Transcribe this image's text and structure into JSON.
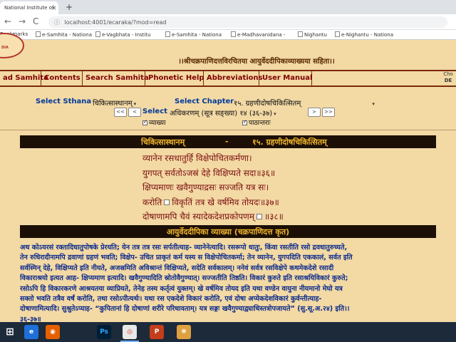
{
  "browser": {
    "tab_title": "National Institute of",
    "tab_close": "×",
    "new_tab": "+",
    "back": "←",
    "forward": "→",
    "reload": "C",
    "url": "localhost:4001/ecaraka/?mod=read",
    "url_icon": "ⓘ",
    "bookmarks": [
      "Bookmarks",
      "e-Samhita - Nationa",
      "e-Vagbhata - Institu",
      "e-Samhita - Nationa",
      "e-Madhavanidana -",
      "Nighantu",
      "e-Nighantu - Nationa"
    ]
  },
  "header": {
    "logo_text": "DIA",
    "subtitle": "।।श्रीचक्रपाणिदत्तविरचितया आयुर्वेददीपिकाव्याख्यया सहिता।।"
  },
  "menu": {
    "items": [
      "ad Samhita",
      "Contents",
      "Search Samhita",
      "Phonetic Help",
      "Abbreviations",
      "User Manual"
    ],
    "right_line1": "Cho",
    "right_line2": "DE"
  },
  "selectors": {
    "sthana_label": "Select Sthana",
    "sthana_value": "चिकित्सास्थानम्",
    "chapter_label": "Select Chapter",
    "chapter_value": "१५. ग्रहणीदोषचिकित्सितम्",
    "select_label": "Select",
    "adhikarana_value": "अधिकरणम् (सूत्र सङ्ख्या)   १४ (३६-३७)",
    "first_btn": "<<",
    "prev_btn": "<",
    "next_btn": ">",
    "last_btn": ">>",
    "caret": "▾",
    "vyakhya_label": "व्याख्या",
    "pathantara_label": "पाठान्तराः"
  },
  "section_header": {
    "sthana": "चिकित्सास्थानम्",
    "dash": "-",
    "chapter": "१५. ग्रहणीदोषचिकित्सितम्"
  },
  "verses": [
    "व्यानेन रसधातुर्हि विक्षेपोचितकर्मणा।",
    "युगपत् सर्वतोऽजस्रं देहे विक्षिप्यते सदा॥३६॥",
    "क्षिप्यमाणः खवैगुण्याद्रसः सज्जति यत्र सः।",
    "करोति",
    "विकृतिं तत्र खे वर्षमिव तोयदः॥३७॥",
    "दोषाणामपि चैवं स्यादेकदेशप्रकोपणम्",
    "॥३८॥"
  ],
  "commentary": {
    "title": "आयुर्वेददीपिका व्याख्या (चक्रपाणिदत्त कृत)",
    "lines": [
      "अथ कोऽयरसं रक्तादिधातुपोषके प्रेरयति; येन तत्र तत्र रसः सर्पतीत्याह- व्यानेनेत्यादि। रसरूपो धातुः, किंवा रसतीति रसो द्रवधातुरुच्यते,",
      "तेन रुधिरादीनामपि द्रवाणां ग्रहणं भवति; विक्षेप- उचित प्राकृतं कर्म यस्य स विक्षेपोचितकर्मा; तेन व्यानेन, युगपदिति एककालं, सर्वत इति",
      "सर्वस्मिन् देहे, विक्षिप्यते इति नीयते, अजस्रमिति अविश्रान्तं विक्षिप्यते, सदेति सर्वकालम्। ननेवं सर्वत्र रसविक्षेपे कथमेकदेशे रसादी",
      "विकाराश्रयो इत्यत आह- क्षिप्यमाण इत्यादि। खवैगुण्यादिति स्रोतोवैगुण्यात्। सज्जतीति तिष्ठति। विकारं कुरुते इति रसाश्रयिविकारं कुरुते;",
      "रसोऽपि हि विकारकरणे आश्रयतया व्याप्रियते, तेनेह तस्य कर्तृत्वं युक्तम्। खे वर्षमिव तोयद इति यथा वण्डेन वायुना नीयमानो मेघो यत्र",
      "सक्तो भवति तत्रैव वर्षं करोति, तथा रसोऽपीत्यर्थः। यथा रस एकदेशे विकारं करोति, एवं दोषा अप्येकदेशविकारं कुर्वन्तीत्याह-",
      "दोषाणामित्यादि। सुश्रुतेऽप्याह- “कुपितानां हि दोषाणां शरीरे परिधावताम्। यत्र सङ्गः खवैगुण्याद्व्याधिस्तत्रोपजायते” (सु.सू.अ.२४) इति।।",
      "३६-३७॥"
    ]
  },
  "taskbar": {
    "icons": [
      "⊞",
      "e",
      "◉",
      "Ps",
      "◎",
      "P",
      "❋"
    ]
  },
  "colors": {
    "page_bg": "#f3d9a4",
    "menu_text": "#800000",
    "band_bg": "#1b0f06",
    "band_text": "#f0b52e",
    "verse_text": "#7b1010",
    "commentary_text": "#0a2a8c"
  }
}
